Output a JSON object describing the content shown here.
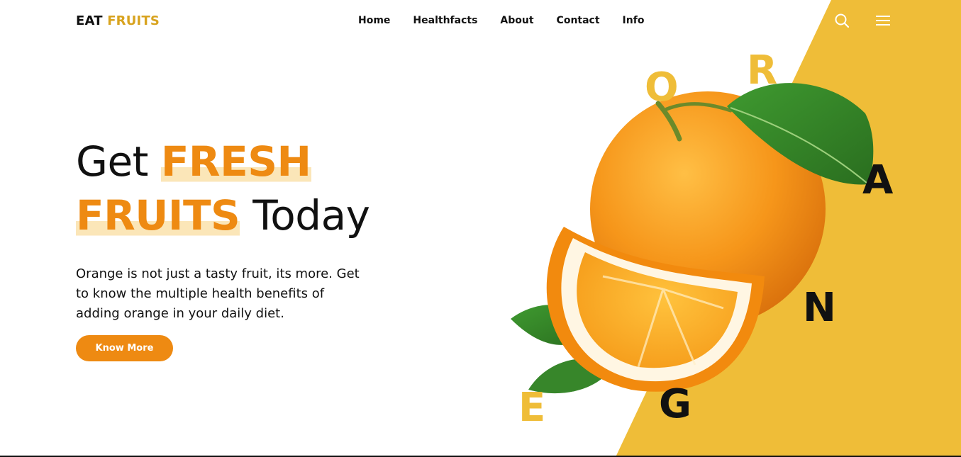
{
  "header": {
    "logo_primary": "EAT",
    "logo_accent": "FRUITS",
    "nav": [
      "Home",
      "Healthfacts",
      "About",
      "Contact",
      "Info"
    ]
  },
  "hero": {
    "word_get": "Get",
    "word_fresh": "FRESH",
    "word_fruits": "FRUITS",
    "word_today": "Today",
    "description": "Orange is not just a tasty fruit, its more. Get to know the multiple health benefits of adding orange in your daily diet.",
    "cta_label": "Know More"
  },
  "letters": [
    "O",
    "R",
    "A",
    "N",
    "G",
    "E"
  ],
  "colors": {
    "accent_orange": "#ee8a12",
    "accent_yellow": "#efbd38",
    "highlight": "#fbe6b8",
    "text": "#111111"
  },
  "icons": [
    "search-icon",
    "menu-icon"
  ]
}
